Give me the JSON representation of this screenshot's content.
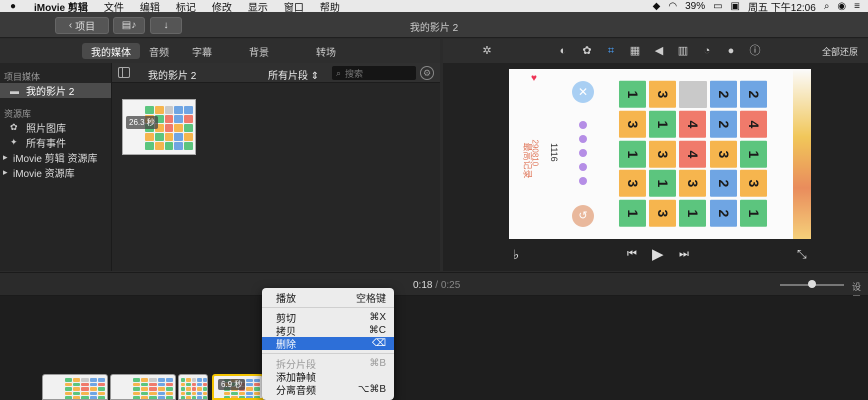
{
  "menubar": {
    "app_name": "iMovie 剪辑",
    "items": [
      "文件",
      "编辑",
      "标记",
      "修改",
      "显示",
      "窗口",
      "帮助"
    ],
    "battery": "39%",
    "clock": "周五 下午12:06"
  },
  "toolbar": {
    "back_label": "项目",
    "project_title": "我的影片 2"
  },
  "tabs": [
    "我的媒体",
    "音频",
    "字幕",
    "背景",
    "转场"
  ],
  "adjust": {
    "reset_label": "全部还原"
  },
  "sidebar": {
    "project_header": "项目媒体",
    "project_item": "我的影片 2",
    "library_header": "资源库",
    "library_items": [
      "照片图库",
      "所有事件"
    ],
    "libraries": [
      "iMovie 剪辑 资源库",
      "iMovie 资源库"
    ]
  },
  "browser": {
    "name": "我的影片 2",
    "filter": "所有片段",
    "search_placeholder": "搜索",
    "thumb_duration": "26.3 秒"
  },
  "viewer": {
    "high_score_label": "最高记录",
    "high_score_value": "290810",
    "score": "1116",
    "board": [
      [
        1,
        3,
        0,
        2,
        2
      ],
      [
        3,
        1,
        4,
        2,
        4
      ],
      [
        1,
        3,
        4,
        3,
        1
      ],
      [
        3,
        1,
        3,
        2,
        3
      ],
      [
        1,
        3,
        1,
        2,
        1
      ]
    ],
    "colors": {
      "1": "#5cc57e",
      "2": "#6fa5e3",
      "3": "#f6b54e",
      "4": "#f07a6b",
      "0": "#c9c9c9"
    }
  },
  "timeline": {
    "current_time": "0:18",
    "separator": "/",
    "total_time": "0:25",
    "settings_label": "设置",
    "selected_clip_duration": "6.9 秒"
  },
  "context_menu": {
    "items": [
      {
        "label": "播放",
        "shortcut": "空格键",
        "state": "normal"
      },
      {
        "sep": true
      },
      {
        "label": "剪切",
        "shortcut": "⌘X",
        "state": "normal"
      },
      {
        "label": "拷贝",
        "shortcut": "⌘C",
        "state": "normal"
      },
      {
        "label": "删除",
        "shortcut": "⌫",
        "state": "highlighted"
      },
      {
        "sep": true
      },
      {
        "label": "拆分片段",
        "shortcut": "⌘B",
        "state": "disabled"
      },
      {
        "label": "添加静帧",
        "shortcut": "",
        "state": "normal"
      },
      {
        "label": "分离音频",
        "shortcut": "⌥⌘B",
        "state": "normal"
      }
    ]
  }
}
